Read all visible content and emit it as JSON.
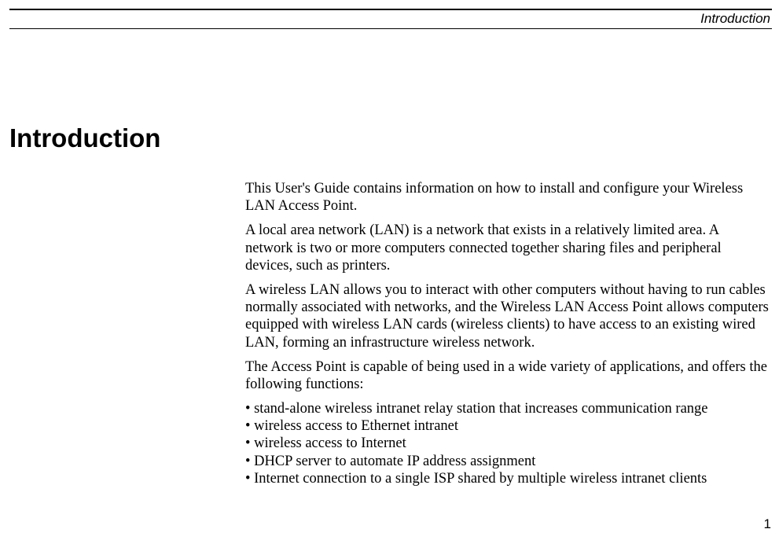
{
  "header": {
    "section_label": "Introduction"
  },
  "heading": "Introduction",
  "body": {
    "p1": "This User's Guide contains information on how to install and configure your Wireless LAN Access Point.",
    "p2": "A local area network (LAN) is a network that exists in a relatively limited area. A network is two or more computers connected together sharing files and peripheral devices, such as printers.",
    "p3": "A wireless LAN allows you to interact with other computers without having to run cables normally associated with networks, and the Wireless LAN Access Point allows computers equipped with wireless LAN cards (wireless clients) to have access to an existing wired LAN, forming an infrastructure wireless network.",
    "p4": "The Access Point is capable of being used in a wide variety of applications, and offers the following functions:",
    "bullets": {
      "b1": "• stand-alone wireless intranet relay station that increases communication range",
      "b2": "• wireless access to Ethernet intranet",
      "b3": "• wireless access to Internet",
      "b4": "• DHCP server to automate IP address assignment",
      "b5": "• Internet connection to a single ISP shared by multiple wireless intranet clients"
    }
  },
  "page_number": "1"
}
